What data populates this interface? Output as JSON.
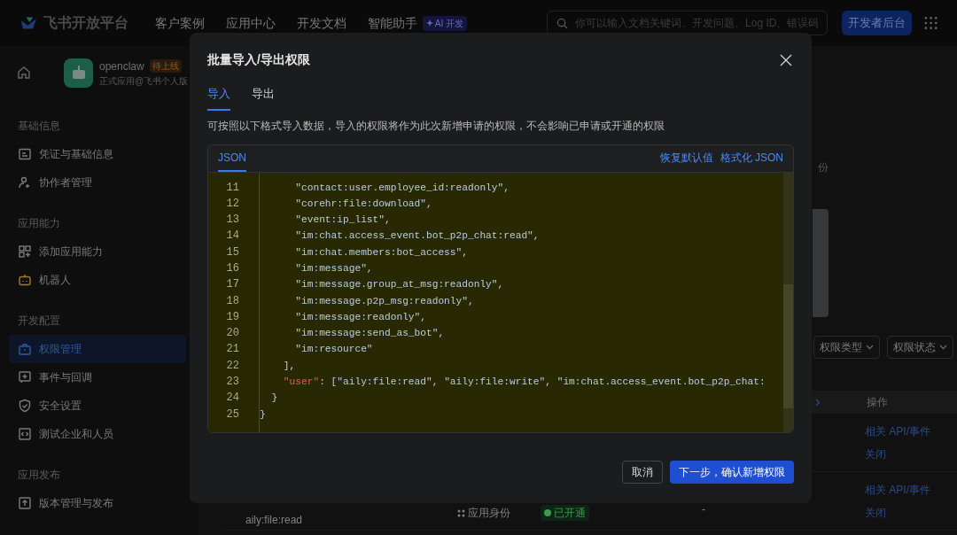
{
  "top_nav": {
    "logo_text": "飞书开放平台",
    "links": [
      "客户案例",
      "应用中心",
      "开发文档",
      "智能助手"
    ],
    "ai_badge": "AI 开发",
    "search": {
      "placeholder": "你可以输入文档关键词、开发问题、Log ID、错误码"
    },
    "console_button": "开发者后台"
  },
  "app": {
    "name": "openclaw",
    "status": "待上线",
    "subtitle": "正式应用@飞书个人版"
  },
  "sidebar": {
    "groups": [
      {
        "title": "基础信息",
        "items": [
          {
            "label": "凭证与基础信息",
            "kind": "credentials",
            "selected": false
          },
          {
            "label": "协作者管理",
            "kind": "people",
            "selected": false
          }
        ]
      },
      {
        "title": "应用能力",
        "items": [
          {
            "label": "添加应用能力",
            "kind": "apps",
            "selected": false
          },
          {
            "label": "机器人",
            "kind": "robot",
            "selected": false
          }
        ]
      },
      {
        "title": "开发配置",
        "items": [
          {
            "label": "权限管理",
            "kind": "permissions",
            "selected": true
          },
          {
            "label": "事件与回调",
            "kind": "events",
            "selected": false
          },
          {
            "label": "安全设置",
            "kind": "security",
            "selected": false
          },
          {
            "label": "测试企业和人员",
            "kind": "testing",
            "selected": false
          }
        ]
      },
      {
        "title": "应用发布",
        "items": [
          {
            "label": "版本管理与发布",
            "kind": "release",
            "selected": false
          }
        ]
      }
    ]
  },
  "background_page": {
    "side_text": "份",
    "filters": [
      "权限类型",
      "权限状态"
    ],
    "table": {
      "header": "操作",
      "rows": [
        {
          "actions": [
            "相关 API/事件",
            "关闭"
          ]
        },
        {
          "name": "aily:file:read",
          "identity": "应用身份",
          "status": "已开通",
          "column_4": "-",
          "actions": [
            "相关 API/事件",
            "关闭"
          ]
        }
      ]
    }
  },
  "modal": {
    "title": "批量导入/导出权限",
    "tabs": [
      {
        "label": "导入",
        "selected": true
      },
      {
        "label": "导出",
        "selected": false
      }
    ],
    "description": "可按照以下格式导入数据，导入的权限将作为此次新增申请的权限，不会影响已申请或开通的权限",
    "editor": {
      "tab": "JSON",
      "actions": [
        "恢复默认值",
        "格式化 JSON"
      ],
      "lines": [
        {
          "number": "11",
          "text": "      \"contact:user.employee_id:readonly\","
        },
        {
          "number": "12",
          "text": "      \"corehr:file:download\","
        },
        {
          "number": "13",
          "text": "      \"event:ip_list\","
        },
        {
          "number": "14",
          "text": "      \"im:chat.access_event.bot_p2p_chat:read\","
        },
        {
          "number": "15",
          "text": "      \"im:chat.members:bot_access\","
        },
        {
          "number": "16",
          "text": "      \"im:message\","
        },
        {
          "number": "17",
          "text": "      \"im:message.group_at_msg:readonly\","
        },
        {
          "number": "18",
          "text": "      \"im:message.p2p_msg:readonly\","
        },
        {
          "number": "19",
          "text": "      \"im:message:readonly\","
        },
        {
          "number": "20",
          "text": "      \"im:message:send_as_bot\","
        },
        {
          "number": "21",
          "text": "      \"im:resource\""
        },
        {
          "number": "22",
          "text": "    ],"
        },
        {
          "number": "23",
          "key": "    \"user\"",
          "text": ": [\"aily:file:read\", \"aily:file:write\", \"im:chat.access_event.bot_p2p_chat:"
        },
        {
          "number": "24",
          "text": "  }"
        },
        {
          "number": "25",
          "text": "}"
        }
      ]
    },
    "buttons": [
      {
        "label": "取消",
        "kind": "secondary"
      },
      {
        "label": "下一步，确认新增权限",
        "kind": "primary"
      }
    ]
  }
}
